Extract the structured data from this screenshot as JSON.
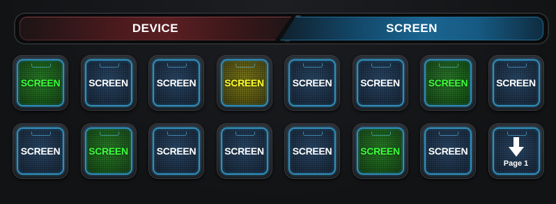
{
  "tabs": {
    "device_label": "DEVICE",
    "screen_label": "SCREEN",
    "active": "SCREEN"
  },
  "keys": [
    {
      "label": "SCREEN",
      "style": "green"
    },
    {
      "label": "SCREEN",
      "style": "blue"
    },
    {
      "label": "SCREEN",
      "style": "blue"
    },
    {
      "label": "SCREEN",
      "style": "yellow"
    },
    {
      "label": "SCREEN",
      "style": "blue"
    },
    {
      "label": "SCREEN",
      "style": "blue"
    },
    {
      "label": "SCREEN",
      "style": "green"
    },
    {
      "label": "SCREEN",
      "style": "blue"
    },
    {
      "label": "SCREEN",
      "style": "blue"
    },
    {
      "label": "SCREEN",
      "style": "green"
    },
    {
      "label": "SCREEN",
      "style": "blue"
    },
    {
      "label": "SCREEN",
      "style": "blue"
    },
    {
      "label": "SCREEN",
      "style": "blue"
    },
    {
      "label": "SCREEN",
      "style": "green"
    },
    {
      "label": "SCREEN",
      "style": "blue"
    }
  ],
  "page_key": {
    "icon": "arrow-down-icon",
    "label": "Page 1"
  },
  "colors": {
    "device_tab": "#5a1f22",
    "screen_tab": "#1a6592",
    "key_border": "#2e8fbd",
    "label_green": "#3cff3c",
    "label_yellow": "#ffff2a"
  }
}
